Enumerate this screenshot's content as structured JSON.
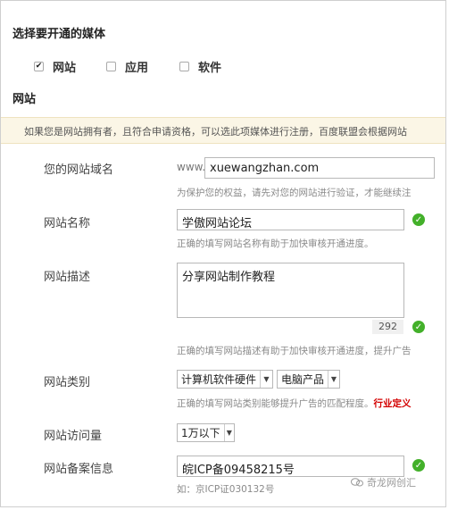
{
  "media_section": {
    "title": "选择要开通的媒体",
    "options": [
      {
        "label": "网站",
        "checked": true
      },
      {
        "label": "应用",
        "checked": false
      },
      {
        "label": "软件",
        "checked": false
      }
    ]
  },
  "website_section": {
    "title": "网站"
  },
  "notice": "如果您是网站拥有者，且符合申请资格，可以选此项媒体进行注册，百度联盟会根据网站",
  "form": {
    "domain": {
      "label": "您的网站域名",
      "prefix": "www.",
      "value": "xuewangzhan.com",
      "hint": "为保护您的权益，请先对您的网站进行验证，才能继续注"
    },
    "name": {
      "label": "网站名称",
      "value": "学傲网站论坛",
      "hint": "正确的填写网站名称有助于加快审核开通进度。"
    },
    "description": {
      "label": "网站描述",
      "value": "分享网站制作教程",
      "counter": "292",
      "hint": "正确的填写网站描述有助于加快审核开通进度，提升广告"
    },
    "category": {
      "label": "网站类别",
      "select1": "计算机软件硬件",
      "select2": "电脑产品",
      "hint": "正确的填写网站类别能够提升广告的匹配程度。",
      "hint_emphasis": "行业定义"
    },
    "traffic": {
      "label": "网站访问量",
      "value": "1万以下"
    },
    "icp": {
      "label": "网站备案信息",
      "value": "皖ICP备09458215号",
      "hint": "如：京ICP证030132号"
    }
  },
  "watermark": "奇龙网创汇",
  "icons": {
    "check": "check-mark-icon",
    "ok": "ok-circle-icon",
    "dropdown": "dropdown-arrow-icon"
  },
  "colors": {
    "ok_green": "#43b02a",
    "notice_bg": "#fbf6e6",
    "emphasis_red": "#d40000"
  }
}
